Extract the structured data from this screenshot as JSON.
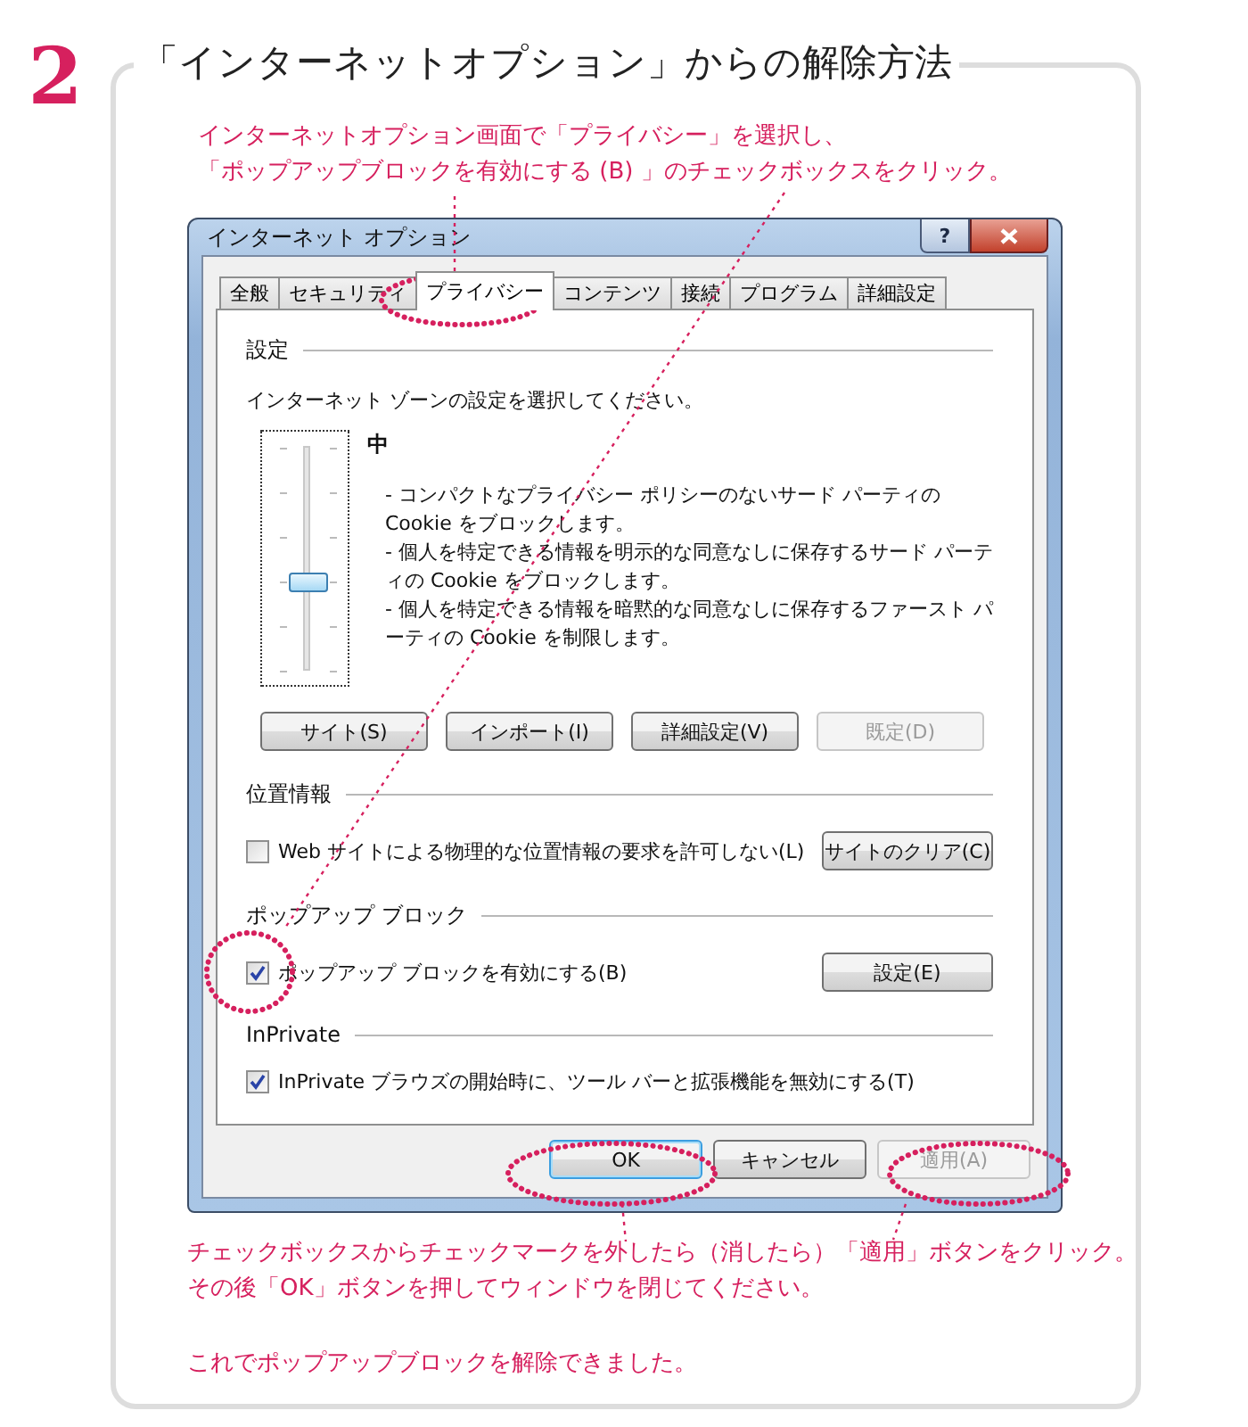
{
  "step_number": "2",
  "title": "「インターネットオプション」からの解除方法",
  "instruction_lines": [
    "インターネットオプション画面で「プライバシー」を選択し、",
    "「ポップアップブロックを有効にする (B) 」のチェックボックスをクリック。"
  ],
  "dialog": {
    "title": "インターネット オプション",
    "help_button": "?",
    "tabs": [
      {
        "label": "全般",
        "selected": false
      },
      {
        "label": "セキュリティ",
        "selected": false
      },
      {
        "label": "プライバシー",
        "selected": true
      },
      {
        "label": "コンテンツ",
        "selected": false
      },
      {
        "label": "接続",
        "selected": false
      },
      {
        "label": "プログラム",
        "selected": false
      },
      {
        "label": "詳細設定",
        "selected": false
      }
    ],
    "settings": {
      "heading": "設定",
      "prompt": "インターネット ゾーンの設定を選択してください。",
      "slider": {
        "level": 0.4
      },
      "level_name": "中",
      "description": [
        "- コンパクトなプライバシー ポリシーのないサード パーティの Cookie をブロックします。",
        "- 個人を特定できる情報を明示的な同意なしに保存するサード パーティの Cookie をブロックします。",
        "- 個人を特定できる情報を暗黙的な同意なしに保存するファースト パーティの Cookie を制限します。"
      ],
      "buttons": [
        {
          "label": "サイト(S)",
          "disabled": false
        },
        {
          "label": "インポート(I)",
          "disabled": false
        },
        {
          "label": "詳細設定(V)",
          "disabled": false
        },
        {
          "label": "既定(D)",
          "disabled": true
        }
      ]
    },
    "location": {
      "heading": "位置情報",
      "checkbox": {
        "label": "Web サイトによる物理的な位置情報の要求を許可しない(L)",
        "checked": false
      },
      "button": {
        "label": "サイトのクリア(C)",
        "disabled": false
      }
    },
    "popup": {
      "heading": "ポップアップ ブロック",
      "checkbox": {
        "label": "ポップアップ ブロックを有効にする(B)",
        "checked": true
      },
      "button": {
        "label": "設定(E)",
        "disabled": false
      }
    },
    "inprivate": {
      "heading": "InPrivate",
      "checkbox": {
        "label": "InPrivate ブラウズの開始時に、ツール バーと拡張機能を無効にする(T)",
        "checked": true
      }
    },
    "footer_buttons": [
      {
        "label": "OK",
        "disabled": false,
        "default": true
      },
      {
        "label": "キャンセル",
        "disabled": false,
        "default": false
      },
      {
        "label": "適用(A)",
        "disabled": true,
        "default": false
      }
    ]
  },
  "note_lines": [
    "チェックボックスからチェックマークを外したら（消したら）「適用」ボタンをクリック。",
    "その後「OK」ボタンを押してウィンドウを閉じてください。"
  ],
  "note_conclusion": "これでポップアップブロックを解除できました。"
}
